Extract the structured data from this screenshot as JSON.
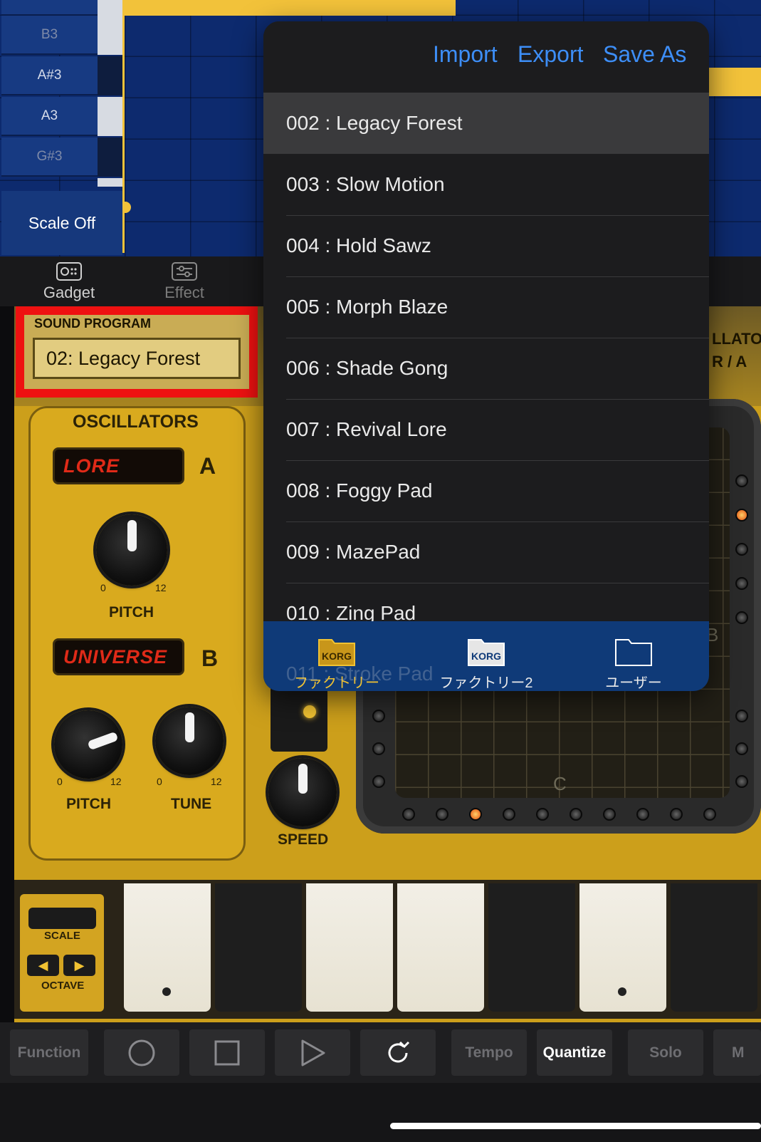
{
  "piano_roll": {
    "keys": [
      {
        "label": "B3",
        "dim": true
      },
      {
        "label": "A#3",
        "dim": false
      },
      {
        "label": "A3",
        "dim": false
      },
      {
        "label": "G#3",
        "dim": true
      }
    ],
    "scale_button": "Scale Off"
  },
  "tabs": [
    {
      "label": "Gadget",
      "icon": "gadget-icon"
    },
    {
      "label": "Effect",
      "icon": "effect-icon"
    }
  ],
  "device": {
    "sound_program_label": "SOUND PROGRAM",
    "sound_program_value": "02: Legacy Forest",
    "oscillators_title": "OSCILLATORS",
    "osc_a_display": "LORE",
    "osc_a_letter": "A",
    "osc_b_display": "UNIVERSE",
    "osc_b_letter": "B",
    "pitch_label": "PITCH",
    "tune_label": "TUNE",
    "speed_label": "SPEED",
    "scale_min": "0",
    "scale_max": "12",
    "grid_note_c": "C",
    "grid_note_b": "B",
    "mode_text": "LLATO\nR / A",
    "keyboard_scale_label": "SCALE",
    "keyboard_octave_label": "OCTAVE",
    "accent_color": "#f1c232",
    "led_color": "#e02a18"
  },
  "popover": {
    "header_buttons": [
      "Import",
      "Export",
      "Save As"
    ],
    "programs": [
      {
        "label": "002 : Legacy Forest",
        "selected": true
      },
      {
        "label": "003 : Slow Motion",
        "selected": false
      },
      {
        "label": "004 : Hold Sawz",
        "selected": false
      },
      {
        "label": "005 : Morph Blaze",
        "selected": false
      },
      {
        "label": "006 : Shade Gong",
        "selected": false
      },
      {
        "label": "007 : Revival Lore",
        "selected": false
      },
      {
        "label": "008 : Foggy Pad",
        "selected": false
      },
      {
        "label": "009 : MazePad",
        "selected": false
      },
      {
        "label": "010 : Zing Pad",
        "selected": false
      }
    ],
    "partial_row": "011 : Stroke Pad",
    "folders": [
      {
        "label": "ファクトリー",
        "icon": "korg-folder-icon",
        "active": true
      },
      {
        "label": "ファクトリー2",
        "icon": "korg-folder-icon",
        "active": false
      },
      {
        "label": "ユーザー",
        "icon": "folder-icon",
        "active": false
      }
    ],
    "link_color": "#3d8ef7"
  },
  "transport": {
    "function_label": "Function",
    "tempo_label": "Tempo",
    "quantize_label": "Quantize",
    "solo_label": "Solo",
    "more_label": "M"
  }
}
